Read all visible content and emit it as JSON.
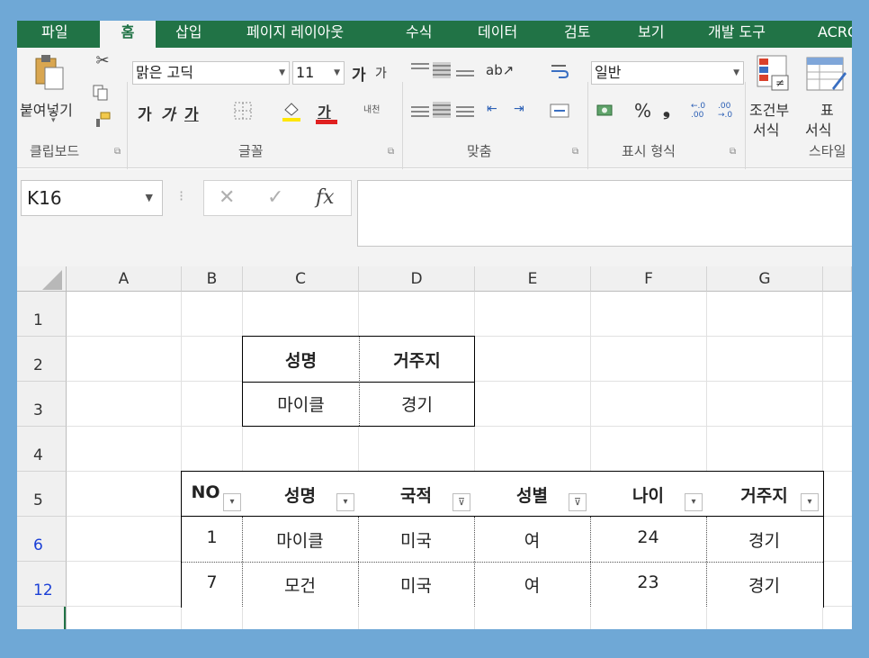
{
  "tabs": [
    "파일",
    "홈",
    "삽입",
    "페이지 레이아웃",
    "수식",
    "데이터",
    "검토",
    "보기",
    "개발 도구",
    "ACRO"
  ],
  "ribbon": {
    "paste_label": "붙여넣기",
    "font_name": "맑은 고딕",
    "font_size": "11",
    "grow_font": "가",
    "shrink_font": "가",
    "bold": "가",
    "italic": "가",
    "underline": "가",
    "font_color_glyph": "가",
    "phonetic": "내천",
    "number_format": "일반",
    "percent": "%",
    "comma": "❟",
    "inc_decimal": "←.0\n.00",
    "conditional_format_line1": "조건부",
    "conditional_format_line2": "서식",
    "table_format_line1": "표",
    "table_format_line2": "서식",
    "groups": {
      "clipboard": "클립보드",
      "font": "글꼴",
      "alignment": "맞춤",
      "number": "표시 형식",
      "styles": "스타일"
    }
  },
  "formula_bar": {
    "name_box": "K16",
    "cancel": "✕",
    "enter": "✓",
    "fx": "fx",
    "content": ""
  },
  "columns": [
    "A",
    "B",
    "C",
    "D",
    "E",
    "F",
    "G"
  ],
  "rows": [
    "1",
    "2",
    "3",
    "4",
    "5",
    "6",
    "12"
  ],
  "criteria_table": {
    "headers": [
      "성명",
      "거주지"
    ],
    "row": [
      "마이클",
      "경기"
    ]
  },
  "main_table": {
    "headers": [
      "NO",
      "성명",
      "국적",
      "성별",
      "나이",
      "거주지"
    ],
    "rows": [
      [
        "1",
        "마이클",
        "미국",
        "여",
        "24",
        "경기"
      ],
      [
        "7",
        "모건",
        "미국",
        "여",
        "23",
        "경기"
      ]
    ]
  },
  "colors": {
    "accent": "#217346",
    "filtered_row_number": "#1a3fd6"
  }
}
